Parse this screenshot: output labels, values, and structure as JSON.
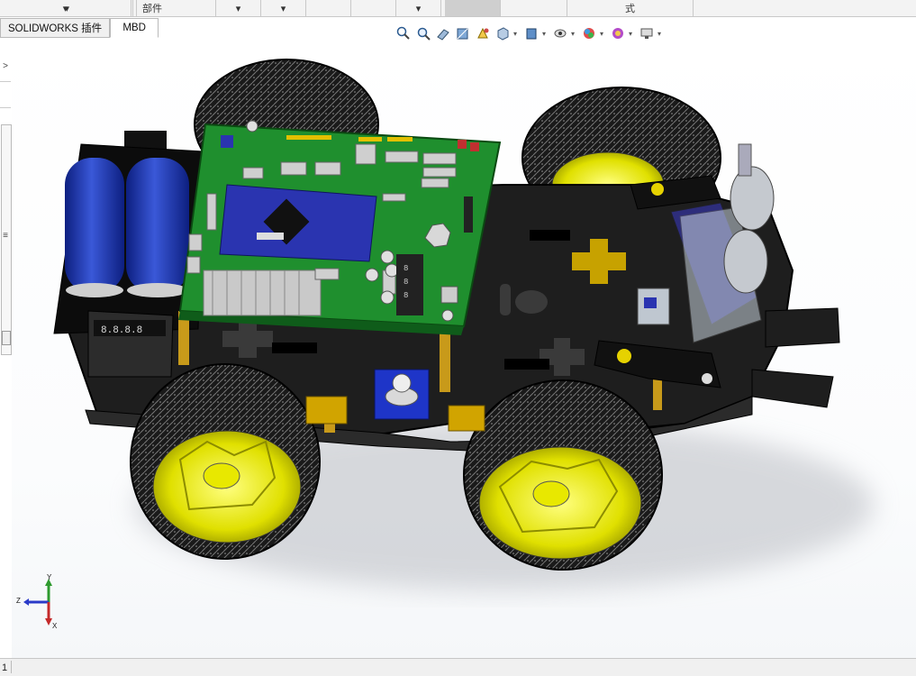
{
  "topbar": {
    "cells": [
      "▾",
      "部件",
      "▾",
      "▾",
      "",
      "",
      "▾",
      "",
      "式",
      ""
    ]
  },
  "tabs": [
    {
      "label": "SOLIDWORKS 插件"
    },
    {
      "label": "MBD"
    }
  ],
  "heads_up_toolbar": {
    "icons": [
      "zoom-to-fit-icon",
      "zoom-to-area-icon",
      "previous-view-icon",
      "section-view-icon",
      "dynamic-annotation-icon",
      "view-orientation-icon",
      "display-style-icon",
      "hide-show-items-icon",
      "edit-appearance-icon",
      "apply-scene-icon",
      "view-settings-icon"
    ]
  },
  "left_strip": {
    "arrow": ">",
    "grip": "≡"
  },
  "triad": {
    "x": "X",
    "y": "Y",
    "z": "Z"
  },
  "status": {
    "page": "1"
  },
  "colors": {
    "chassis": "#1e1e1e",
    "wheel_hub": "#e6e600",
    "pcb": "#1f8f2e",
    "battery": "#1e35a8",
    "module_blue": "#2a34b0"
  }
}
